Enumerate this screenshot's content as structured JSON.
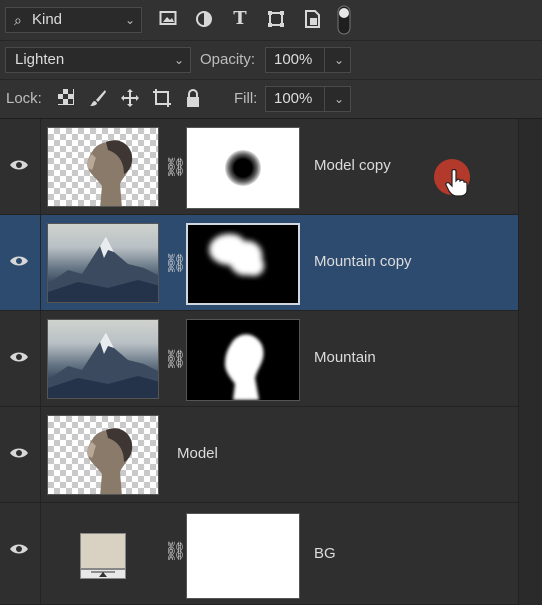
{
  "filter_bar": {
    "kind_label": "Kind",
    "icons": [
      "image-filter-icon",
      "adjustment-filter-icon",
      "type-filter-icon",
      "shape-filter-icon",
      "smart-object-filter-icon",
      "filter-toggle-icon"
    ]
  },
  "blend_bar": {
    "blend_mode": "Lighten",
    "opacity_label": "Opacity:",
    "opacity_value": "100%"
  },
  "lock_bar": {
    "lock_label": "Lock:",
    "fill_label": "Fill:",
    "fill_value": "100%",
    "lock_icons": [
      "lock-transparent-icon",
      "lock-paint-icon",
      "lock-position-icon",
      "lock-artboard-icon",
      "lock-all-icon"
    ]
  },
  "layers": [
    {
      "name": "Model copy",
      "thumbnail": "woman-portrait-transparent",
      "mask": "white-with-black-blurred-dot",
      "selected": false,
      "linked": true
    },
    {
      "name": "Mountain copy",
      "thumbnail": "mountain-landscape",
      "mask": "black-with-white-blob",
      "selected": true,
      "linked": true
    },
    {
      "name": "Mountain",
      "thumbnail": "mountain-landscape",
      "mask": "black-with-white-head-silhouette",
      "selected": false,
      "linked": true
    },
    {
      "name": "Model",
      "thumbnail": "woman-portrait-transparent",
      "mask": null,
      "selected": false,
      "linked": false
    },
    {
      "name": "BG",
      "thumbnail": "solid-color-fill",
      "mask": "white",
      "selected": false,
      "linked": true
    }
  ],
  "colors": {
    "panel_bg": "#2f2f2f",
    "selected_row": "#2c4b6e",
    "cursor_highlight": "#b33a2b",
    "bg_fill": "#d9d2c2"
  }
}
